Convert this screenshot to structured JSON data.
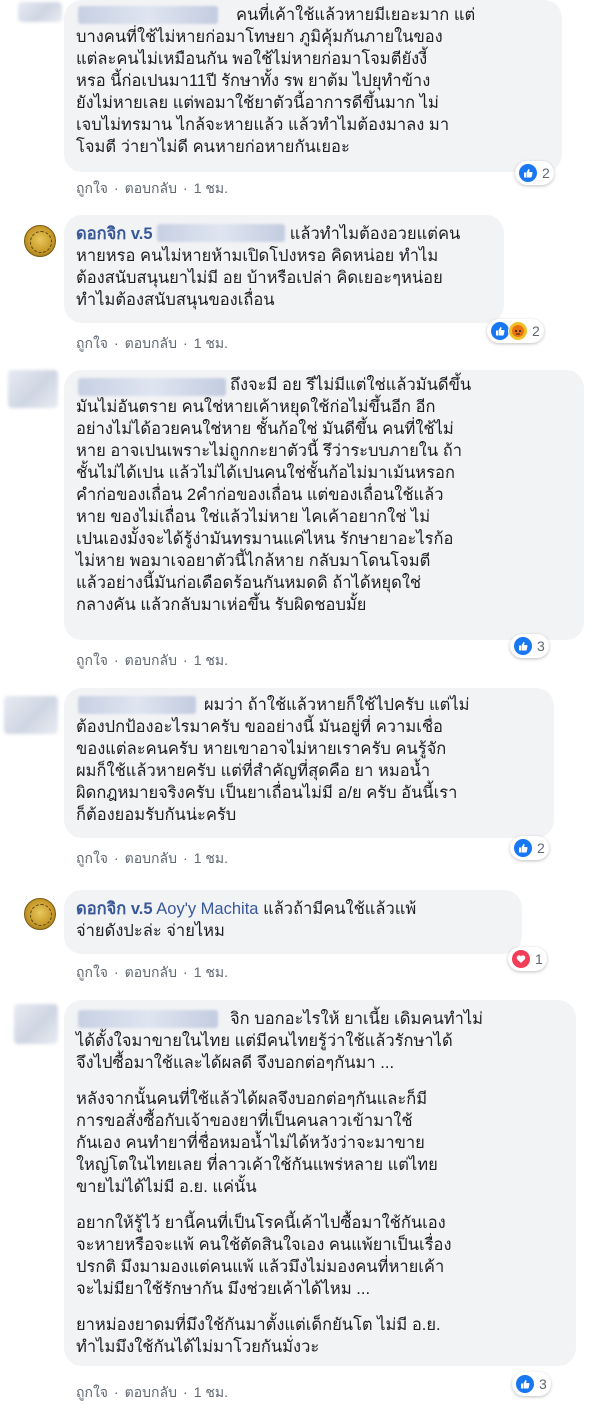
{
  "actions": {
    "like": "ถูกใจ",
    "reply": "ตอบกลับ",
    "time": "1 ชม."
  },
  "comments": [
    {
      "author": "",
      "mention": "",
      "paragraphs": [
        "คนที่เค้าใช้แล้วหายมีเยอะมาก แต่\nบางคนที่ใช้ไม่หายก่อมาโทษยา ภูมิคุ้มกันภายในของ\nแต่ละคนไม่เหมือนกัน พอใช้ไม่หายก่อมาโจมตียังงี้\nหรอ นี้ก่อเปนมา11ปี รักษาทั้ง รพ ยาต้ม ไปยุทำข้าง\nยังไม่หายเลย แต่พอมาใช้ยาตัวนี้อาการดีขึ้นมาก ไม่\nเจบไม่ทรมาน ไกล้จะหายแล้ว แล้วทำไมต้องมาลง มา\nโจมตี ว่ายาไม่ดี คนหายก่อหายกันเยอะ"
      ],
      "reaction_count": "2",
      "reactions": [
        "like"
      ]
    },
    {
      "author": "ดอกจิก v.5",
      "mention": "",
      "paragraphs": [
        "แล้วทำไมต้องอวยแต่คน\nหายหรอ คนไม่หายห้ามเปิดโปงหรอ คิดหน่อย ทำไม\nต้องสนับสนุนยาไม่มี อย บ้าหรือเปล่า คิดเยอะๆหน่อย\nทำไมต้องสนับสนุนของเถื่อน"
      ],
      "reaction_count": "2",
      "reactions": [
        "like",
        "angry"
      ]
    },
    {
      "author": "",
      "mention": "",
      "paragraphs": [
        "ถึงจะมี อย รึไม่มีแต่ใช่แล้วมันดีขึ้น\nมันไม่อันตราย คนใช่หายเค้าหยุดใช้ก่อไม่ขึ้นอีก อีก\nอย่างไม่ได้อวยคนใช่หาย ชั้นก้อใช่ มันดีขึ้น คนที่ใช้ไม่\nหาย อาจเปนเพราะไม่ถูกกะยาตัวนี้ รึว่าระบบภายใน ถ้า\nชั้นไม่ได้เปน แล้วไม่ได้เปนคนใช่ชั้นก้อไม่มาเม้นหรอก\nคำก่อของเถื่อน 2คำก่อของเถื่อน แต่ของเถื่อนใช้แล้ว\nหาย ของไม่เถื่อน ใช่แล้วไม่หาย ไคเค้าอยากใช่ ไม่\nเปนเองมั้งจะได้รู้ง่ามันทรมานแค่ไหน รักษายาอะไรก้อ\nไม่หาย พอมาเจอยาตัวนี้ไกล้หาย กลับมาโดนโจมตี\nแล้วอย่างนี้มันก่อเดือดร้อนกันหมดดิ ถ้าได้หยุดใช่\nกลางคัน แล้วกลับมาเห่อขึ้น รับผิดชอบมั้ย"
      ],
      "reaction_count": "3",
      "reactions": [
        "like"
      ]
    },
    {
      "author": "",
      "mention": "",
      "paragraphs": [
        "ผมว่า ถ้าใช้แล้วหายก็ใช้ไปครับ แต่ไม่\nต้องปกป้องอะไรมาครับ ขออย่างนี้ มันอยู่ที่ ความเชื่อ\nของแต่ละคนครับ หายเขาอาจไม่หายเราครับ คนรู้จัก\nผมก็ใช้แล้วหายครับ แต่ที่สำคัญที่สุดคือ ยา หมอน้ำ\nผิดกฎหมายจริงครับ เป็นยาเถื่อนไม่มี อ/ย ครับ อันนี้เรา\nก็ต้องยอมรับกันน่ะครับ"
      ],
      "reaction_count": "2",
      "reactions": [
        "like"
      ]
    },
    {
      "author": "ดอกจิก v.5",
      "mention": "Aoy'y Machita",
      "paragraphs": [
        "แล้วถ้ามีคนใช้แล้วแพ้\nจ่ายดังปะล่ะ จ่ายไหม"
      ],
      "reaction_count": "1",
      "reactions": [
        "heart"
      ]
    },
    {
      "author": "",
      "mention": "",
      "paragraphs": [
        "จิก บอกอะไรให้ ยาเนี้ย เดิมคนทำไม่\nได้ตั้งใจมาขายในไทย แต่มีคนไทยรู้ว่าใช้แล้วรักษาได้\nจึงไปซื้อมาใช้และได้ผลดี จึงบอกต่อๆกันมา ...",
        "หลังจากนั้นคนที่ใช้แล้วได้ผลจึงบอกต่อๆกันและก็มี\nการขอสั่งซื้อกับเจ้าของยาที่เป็นคนลาวเข้ามาใช้\nกันเอง คนทำยาที่ชื่อหมอน้ำไม่ได้หวังว่าจะมาขาย\nใหญ่โตในไทยเลย ที่ลาวเค้าใช้กันแพร่หลาย แต่ไทย\nขายไม่ได้ไม่มี อ.ย. แค่นั้น",
        "อยากให้รู้ไว้ ยานี้คนที่เป็นโรคนี้เค้าไปซื้อมาใช้กันเอง\nจะหายหรือจะแพ้ คนใช้ตัดสินใจเอง คนแพ้ยาเป็นเรื่อง\nปรกติ มึงมามองแต่คนแพ้ แล้วมึงไม่มองคนที่หายเค้า\nจะไม่มียาใช้รักษากัน มึงช่วยเค้าได้ไหม ...",
        "ยาหม่องยาดมที่มึงใช้กันมาตั้งแต่เด็กยันโต ไม่มี อ.ย.\nทำไมมึงใช้กันได้ไม่มาโวยกันมั่งวะ"
      ],
      "reaction_count": "3",
      "reactions": [
        "like"
      ]
    }
  ]
}
